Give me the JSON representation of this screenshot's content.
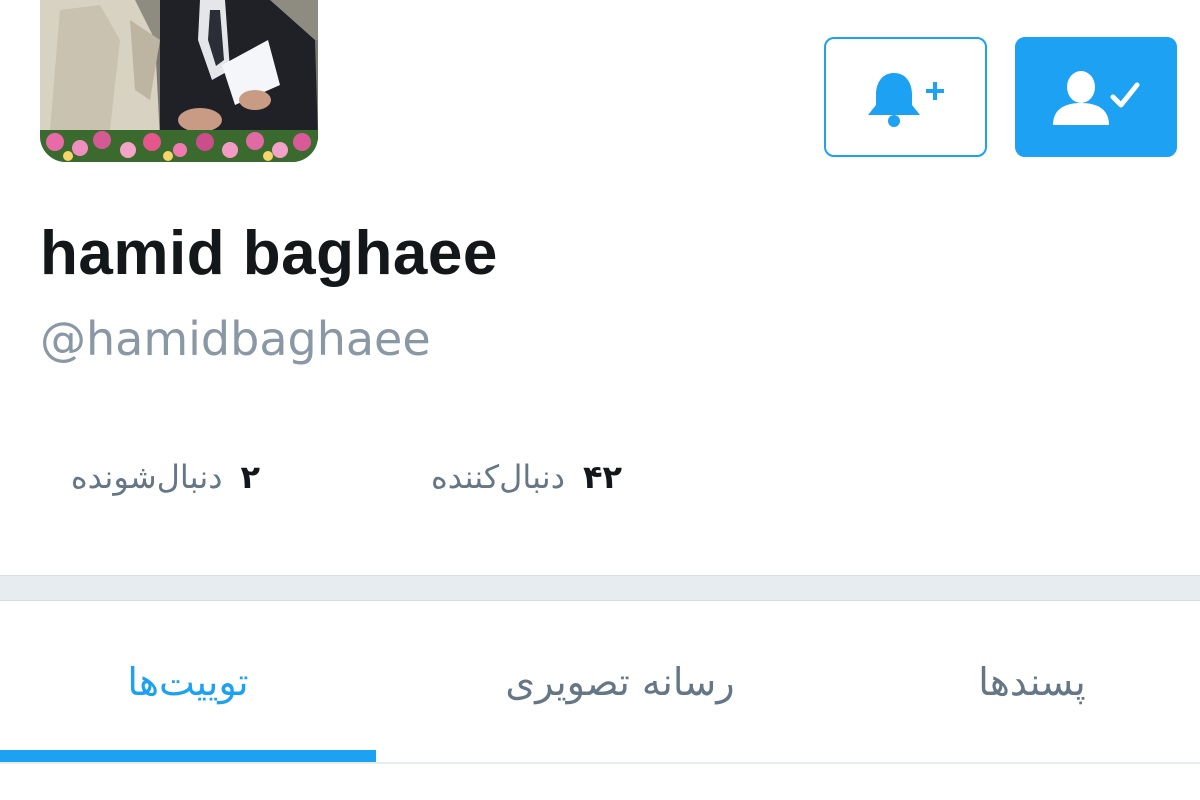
{
  "profile": {
    "display_name": "hamid baghaee",
    "handle": "@hamidbaghaee"
  },
  "stats": {
    "following_count": "۲",
    "following_label": "دنبال‌شونده",
    "followers_count": "۴۲",
    "followers_label": "دنبال‌کننده"
  },
  "actions": {
    "notify_icon": "bell-plus-icon",
    "following_icon": "user-check-icon"
  },
  "tabs": [
    {
      "label": "توییت‌ها",
      "active": true
    },
    {
      "label": "رسانه تصویری",
      "active": false
    },
    {
      "label": "پسندها",
      "active": false
    }
  ],
  "colors": {
    "accent": "#1da1f2",
    "text_primary": "#14171a",
    "text_secondary": "#657786",
    "handle": "#8a98a5",
    "separator": "#e6ecf0"
  }
}
